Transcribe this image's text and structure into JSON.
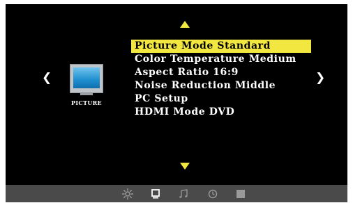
{
  "menu": {
    "items": [
      {
        "label": "Picture Mode",
        "value": "Standard",
        "selected": true
      },
      {
        "label": "Color Temperature",
        "value": "Medium",
        "selected": false
      },
      {
        "label": "Aspect Ratio",
        "value": "16:9",
        "selected": false
      },
      {
        "label": "Noise Reduction",
        "value": "Middle",
        "selected": false
      },
      {
        "label": "PC Setup",
        "value": "",
        "selected": false
      },
      {
        "label": "HDMI Mode",
        "value": "DVD",
        "selected": false
      }
    ]
  },
  "category": {
    "label": "PICTURE",
    "icon": "tv-picture-icon"
  },
  "nav": {
    "prev": "❮",
    "next": "❯"
  },
  "tabs": [
    {
      "name": "sun-icon",
      "active": false
    },
    {
      "name": "monitor-icon",
      "active": true
    },
    {
      "name": "music-note-icon",
      "active": false
    },
    {
      "name": "clock-icon",
      "active": false
    },
    {
      "name": "lock-icon",
      "active": false
    }
  ],
  "colors": {
    "highlight": "#f2e641",
    "background": "#000000",
    "bar": "#4a4a4a",
    "tab_active": "#ffffff",
    "tab_inactive": "#9a9a9a"
  }
}
